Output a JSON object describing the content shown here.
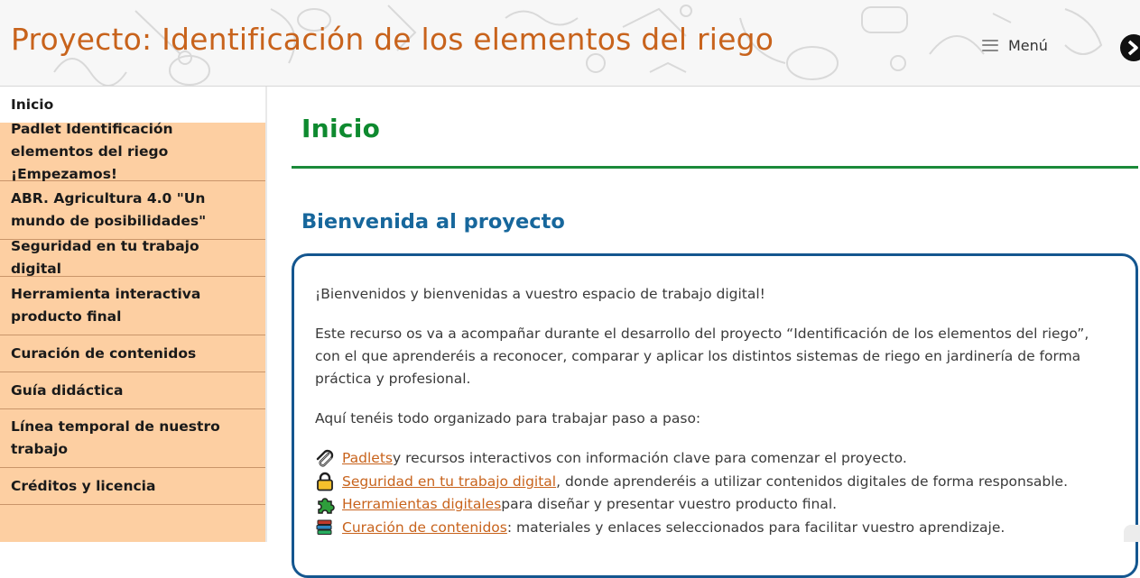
{
  "header": {
    "site_title": "Proyecto: Identificación de los elementos del riego",
    "menu_label": "Menú",
    "menu_icon": "hamburger-icon",
    "next_icon": "chevron-right-icon"
  },
  "sidebar": {
    "items": [
      {
        "label": "Inicio",
        "active": true
      },
      {
        "label": "Padlet Identificación elementos del riego ¡Empezamos!"
      },
      {
        "label": "ABR. Agricultura 4.0 \"Un mundo de posibilidades\""
      },
      {
        "label": "Seguridad en tu trabajo digital"
      },
      {
        "label": "Herramienta interactiva producto final"
      },
      {
        "label": "Curación de contenidos"
      },
      {
        "label": "Guía didáctica"
      },
      {
        "label": "Línea temporal de nuestro trabajo"
      },
      {
        "label": "Créditos y licencia"
      }
    ]
  },
  "main": {
    "page_heading": "Inicio",
    "section_title": "Bienvenida al proyecto",
    "intro": "¡Bienvenidos y bienvenidas a vuestro espacio de trabajo digital!",
    "description": "Este recurso os va a acompañar durante el desarrollo del proyecto “Identificación de los elementos del riego”, con el que aprenderéis a reconocer, comparar y aplicar los distintos sistemas de riego en jardinería de forma práctica y profesional.",
    "organized": "Aquí tenéis todo organizado para trabajar paso a paso:",
    "resources": [
      {
        "icon": "paperclip-icon",
        "link": "Padlets",
        "text": " y recursos interactivos con información clave para comenzar el proyecto."
      },
      {
        "icon": "padlock-icon",
        "link": "Seguridad en tu trabajo digital",
        "text": ", donde aprenderéis a utilizar contenidos digitales de forma responsable."
      },
      {
        "icon": "puzzle-piece-icon",
        "link": "Herramientas digitales",
        "text": " para diseñar y presentar vuestro producto final."
      },
      {
        "icon": "books-icon",
        "link": "Curación de contenidos",
        "text": ": materiales y enlaces seleccionados para facilitar vuestro aprendizaje."
      }
    ]
  },
  "colors": {
    "title_orange": "#c8631c",
    "heading_green": "#0e8a2f",
    "section_blue": "#17679c",
    "sidebar_bg": "#fdcfa2",
    "box_border": "#14568f"
  }
}
